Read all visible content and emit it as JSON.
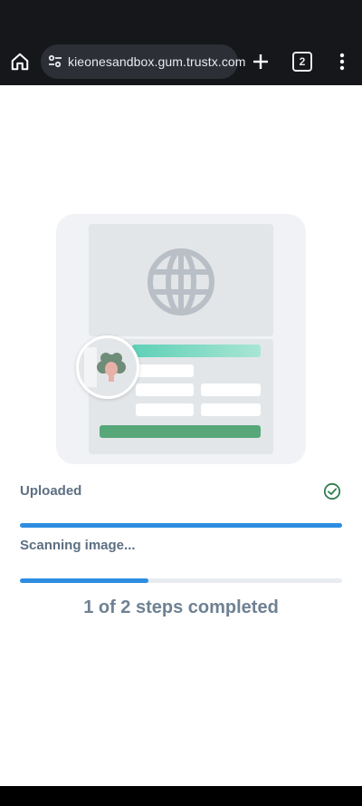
{
  "browser": {
    "url": "kieonesandbox.gum.trustx.com",
    "tab_count": "2"
  },
  "progress": {
    "uploaded_label": "Uploaded",
    "uploaded_progress": 1.0,
    "scanning_label": "Scanning image...",
    "scanning_progress": 0.4,
    "steps_text": "1 of 2 steps completed"
  },
  "colors": {
    "accent": "#2d8de0",
    "success": "#2e7d4f",
    "text": "#5d6f82"
  },
  "icons": {
    "home": "home-icon",
    "site_settings": "tune-icon",
    "new_tab": "plus-icon",
    "menu": "more-vert-icon",
    "uploaded_status": "check-circle-icon",
    "document": "globe-icon"
  }
}
